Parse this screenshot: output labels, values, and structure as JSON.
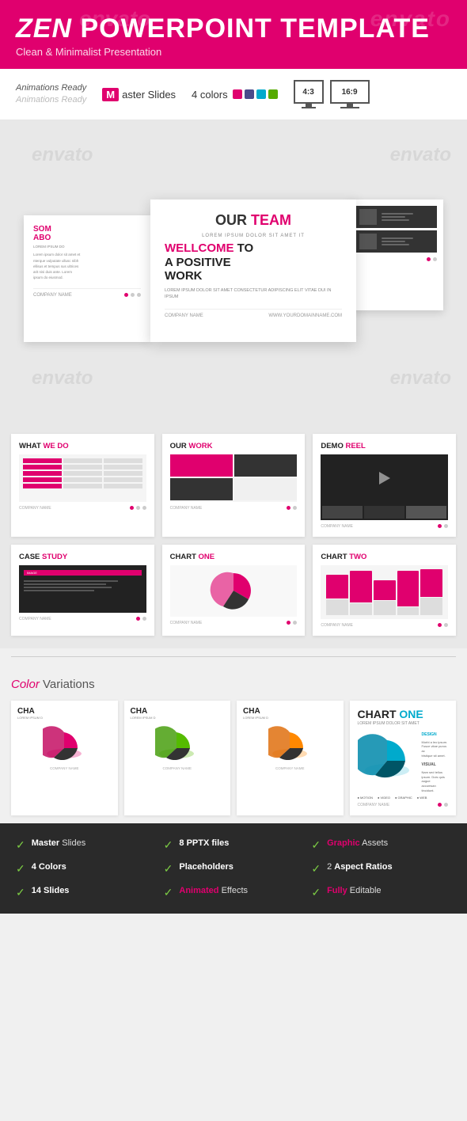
{
  "header": {
    "brand_zen": "ZEN",
    "brand_rest": " POWERPOINT TEMPLATE",
    "subtitle": "Clean & Minimalist Presentation",
    "watermark": "envato"
  },
  "features": {
    "anim_line1": "Animations Ready",
    "anim_line2": "Animations Ready",
    "master_label": "aster Slides",
    "colors_label": "4 colors",
    "ratio_43": "4:3",
    "ratio_169": "16:9"
  },
  "color_dots": [
    {
      "color": "#e0006e"
    },
    {
      "color": "#4a4a8a"
    },
    {
      "color": "#00aacc"
    },
    {
      "color": "#55aa00"
    }
  ],
  "preview": {
    "slide_main": {
      "eyebrow": "LOREM IPSUM DOLOR SIT AMET IT",
      "headline1": "WELLCOME TO",
      "headline2": "A POSITIVE",
      "headline3": "WORK",
      "body": "LOREM IPSUM DOLOR SIT AMET CONSECTETUR ADIPISCING ELIT VITAE DUI IN IPSUM",
      "footer_company": "COMPANY NAME",
      "footer_url": "WWW.YOURDOMAINNAME.COM",
      "title": "OUR TEAM"
    },
    "slide_left": {
      "title1": "SOM",
      "title2": "ABO",
      "lorem": "LOREM IPSUM DO"
    },
    "slide_right": {
      "panel1": "IMAGE",
      "panel2": "IMAGE"
    }
  },
  "thumbs": [
    {
      "title": "WHAT WE DO",
      "type": "wwd",
      "company": "COMPANY NAME"
    },
    {
      "title": "OUR WORK",
      "type": "ow",
      "company": "COMPANY NAME"
    },
    {
      "title": "DEMO REEL",
      "type": "demo",
      "company": "COMPANY NAME"
    },
    {
      "title": "CASE STUDY",
      "type": "case",
      "company": "COMPANY NAME"
    },
    {
      "title": "CHART ONE",
      "type": "pie",
      "company": "COMPANY NAME"
    },
    {
      "title": "CHART TWO",
      "type": "bar",
      "company": "COMPANY NAME"
    }
  ],
  "color_variations": {
    "label_colored": "Color",
    "label_rest": " Variations"
  },
  "color_cards": [
    {
      "title": "CHA",
      "sub": "LOREM IPSUM D",
      "pie_color": "#e0006e"
    },
    {
      "title": "CHA",
      "sub": "LOREM IPSUM D",
      "pie_color": "#55bb00"
    },
    {
      "title": "CHA",
      "sub": "LOREM IPSUM D",
      "pie_color": "#ff8800"
    },
    {
      "title": "CHART ONE",
      "sub": "LOREM IPSUM DOLOR SIT AMET",
      "pie_color": "#00aacc"
    }
  ],
  "bottom_features": [
    {
      "bold": "Master",
      "rest": " Slides"
    },
    {
      "bold": "8 PPTX",
      "rest": " files"
    },
    {
      "bold_pink": "Graphic",
      "rest": " Assets"
    },
    {
      "bold": "4",
      "rest": " Colors"
    },
    {
      "bold": "",
      "rest": "Placeholders"
    },
    {
      "rest": "2 Aspect Ratios"
    },
    {
      "bold": "14",
      "rest": " Slides"
    },
    {
      "bold_pink": "Animated",
      "rest": " Effects"
    },
    {
      "bold_pink": "Fully",
      "rest": " Editable"
    }
  ]
}
